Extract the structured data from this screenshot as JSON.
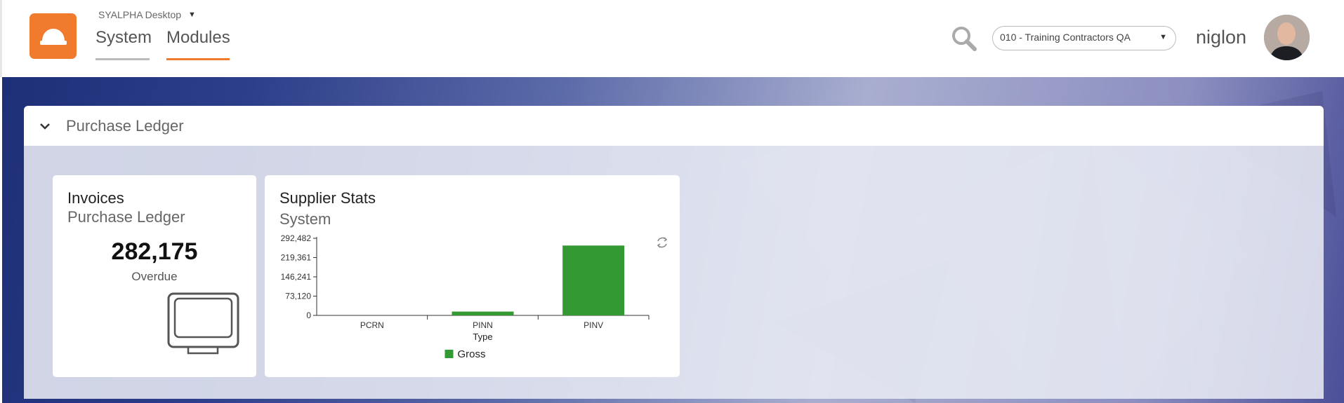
{
  "header": {
    "app_switch_label": "SYALPHA Desktop",
    "tabs": [
      {
        "label": "System",
        "active": false
      },
      {
        "label": "Modules",
        "active": true
      }
    ],
    "company_select": "010 - Training Contractors QA",
    "username": "niglon"
  },
  "panel": {
    "title": "Purchase Ledger"
  },
  "invoices_card": {
    "title": "Invoices",
    "subtitle": "Purchase Ledger",
    "value": "282,175",
    "label": "Overdue",
    "icon": "monitor-icon"
  },
  "stats_card": {
    "title": "Supplier Stats",
    "subtitle": "System"
  },
  "colors": {
    "accent": "#f07b2c",
    "bar": "#339933"
  },
  "chart_data": {
    "type": "bar",
    "categories": [
      "PCRN",
      "PINN",
      "PINV"
    ],
    "series": [
      {
        "name": "Gross",
        "values": [
          0,
          14500,
          265000
        ]
      }
    ],
    "xlabel": "Type",
    "ylabel": "",
    "yticks": [
      "0",
      "73,120",
      "146,241",
      "219,361",
      "292,482"
    ],
    "ylim": [
      0,
      292482
    ],
    "legend": "bottom",
    "grid": false
  }
}
